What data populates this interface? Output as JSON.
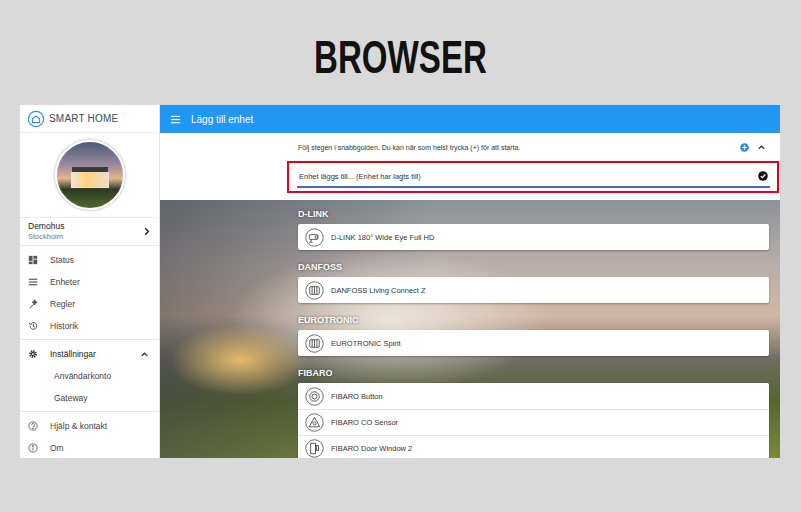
{
  "header": {
    "title": "BROWSER"
  },
  "sidebar": {
    "logo": "SMART HOME",
    "home": {
      "name": "Demohus",
      "location": "Stockholm"
    },
    "sections": [
      {
        "items": [
          {
            "label": "Status",
            "kind": "nav"
          },
          {
            "label": "Enheter",
            "kind": "nav"
          },
          {
            "label": "Regler",
            "kind": "nav"
          },
          {
            "label": "Historik",
            "kind": "nav"
          }
        ]
      },
      {
        "items": [
          {
            "label": "Inställningar",
            "kind": "group",
            "expanded": true
          },
          {
            "label": "Användarkonto",
            "kind": "sub"
          },
          {
            "label": "Gateway",
            "kind": "sub"
          }
        ]
      },
      {
        "items": [
          {
            "label": "Hjälp & kontakt",
            "kind": "nav"
          },
          {
            "label": "Om",
            "kind": "nav"
          }
        ]
      }
    ]
  },
  "toolbar": {
    "title": "Lägg till enhet"
  },
  "guide": {
    "text": "Följ stegen i snabbguiden. Du kan när som helst trycka (+) för att starta.",
    "expanded": true,
    "field": {
      "value": "Enhet läggs till... (Enhet har lagts till)",
      "done": true,
      "highlighted": true
    }
  },
  "groups": [
    {
      "name": "D-LINK",
      "devices": [
        "D-LINK 180° Wide Eye Full HD"
      ]
    },
    {
      "name": "DANFOSS",
      "devices": [
        "DANFOSS Living Connect Z"
      ]
    },
    {
      "name": "EUROTRONIC",
      "devices": [
        "EUROTRONIC Spirit"
      ]
    },
    {
      "name": "FIBARO",
      "devices": [
        "FIBARO Button",
        "FIBARO CO Sensor",
        "FIBARO Door Window 2"
      ]
    }
  ]
}
